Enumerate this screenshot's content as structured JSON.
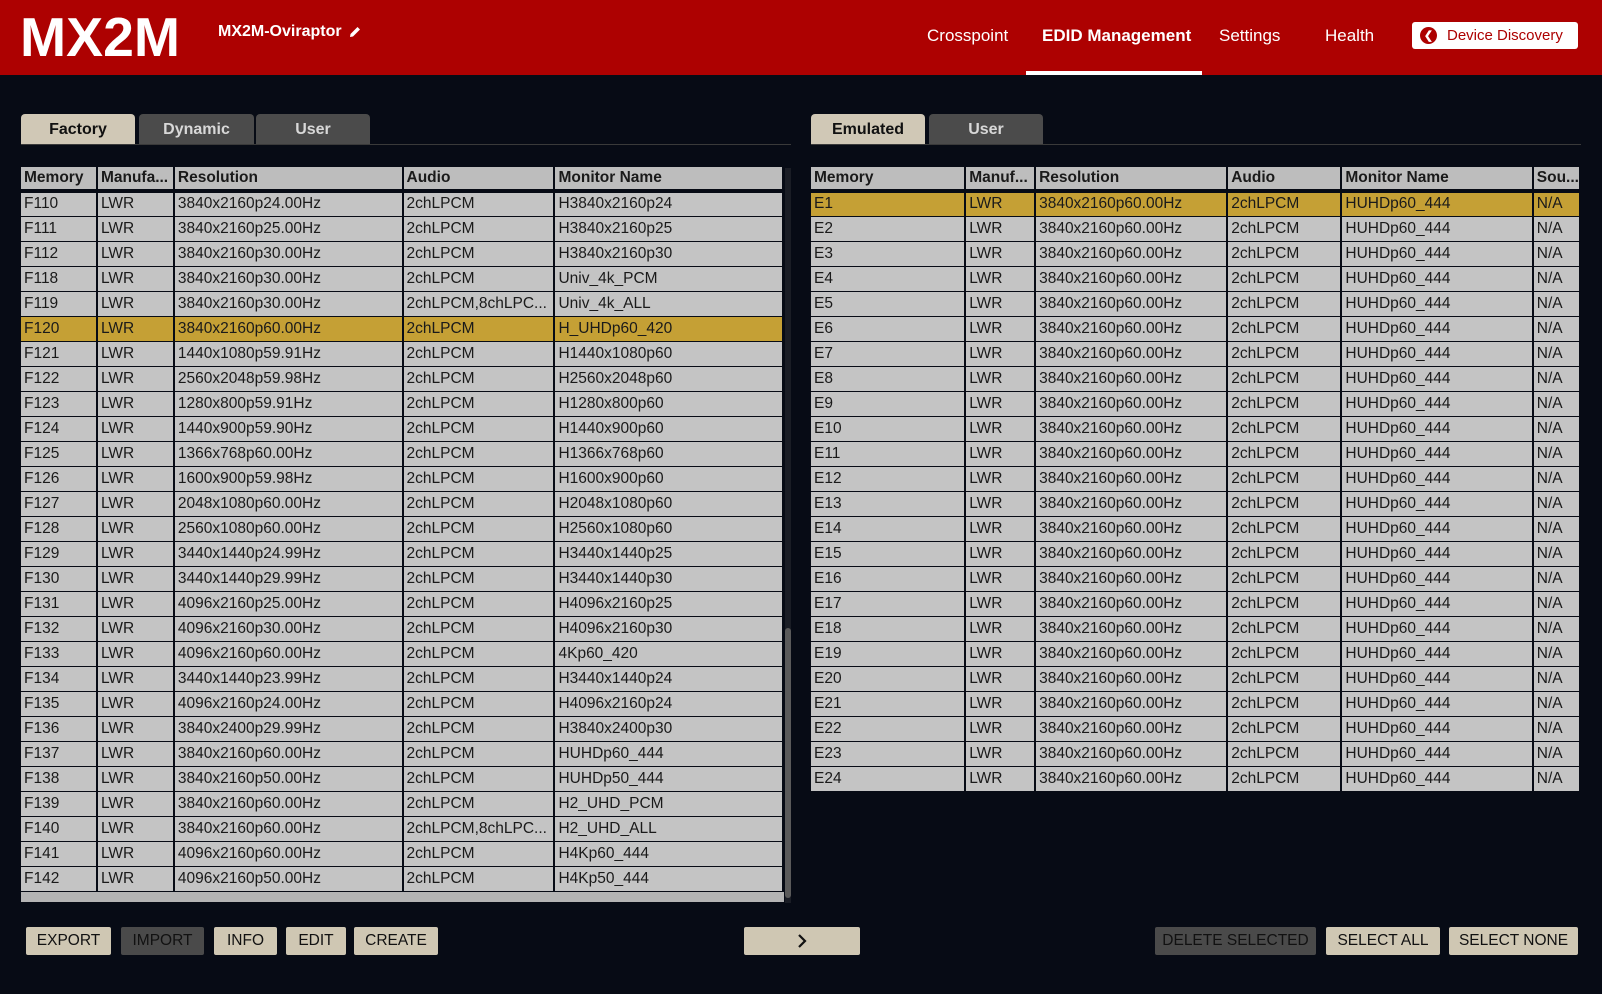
{
  "header": {
    "logo_text": "MX2M",
    "device_name": "MX2M-Oviraptor",
    "nav": [
      "Crosspoint",
      "EDID Management",
      "Settings",
      "Health"
    ],
    "active_nav": "EDID Management",
    "discovery_label": "Device Discovery",
    "brand_color": "#ad0101"
  },
  "left_panel": {
    "tabs": [
      "Factory",
      "Dynamic",
      "User"
    ],
    "active_tab": "Factory",
    "columns": [
      "Memory",
      "Manufa...",
      "Resolution",
      "Audio",
      "Monitor Name"
    ],
    "selected_row": "F120",
    "rows": [
      [
        "F110",
        "LWR",
        "3840x2160p24.00Hz",
        "2chLPCM",
        "H3840x2160p24"
      ],
      [
        "F111",
        "LWR",
        "3840x2160p25.00Hz",
        "2chLPCM",
        "H3840x2160p25"
      ],
      [
        "F112",
        "LWR",
        "3840x2160p30.00Hz",
        "2chLPCM",
        "H3840x2160p30"
      ],
      [
        "F118",
        "LWR",
        "3840x2160p30.00Hz",
        "2chLPCM",
        "Univ_4k_PCM"
      ],
      [
        "F119",
        "LWR",
        "3840x2160p30.00Hz",
        "2chLPCM,8chLPC...",
        "Univ_4k_ALL"
      ],
      [
        "F120",
        "LWR",
        "3840x2160p60.00Hz",
        "2chLPCM",
        "H_UHDp60_420"
      ],
      [
        "F121",
        "LWR",
        "1440x1080p59.91Hz",
        "2chLPCM",
        "H1440x1080p60"
      ],
      [
        "F122",
        "LWR",
        "2560x2048p59.98Hz",
        "2chLPCM",
        "H2560x2048p60"
      ],
      [
        "F123",
        "LWR",
        "1280x800p59.91Hz",
        "2chLPCM",
        "H1280x800p60"
      ],
      [
        "F124",
        "LWR",
        "1440x900p59.90Hz",
        "2chLPCM",
        "H1440x900p60"
      ],
      [
        "F125",
        "LWR",
        "1366x768p60.00Hz",
        "2chLPCM",
        "H1366x768p60"
      ],
      [
        "F126",
        "LWR",
        "1600x900p59.98Hz",
        "2chLPCM",
        "H1600x900p60"
      ],
      [
        "F127",
        "LWR",
        "2048x1080p60.00Hz",
        "2chLPCM",
        "H2048x1080p60"
      ],
      [
        "F128",
        "LWR",
        "2560x1080p60.00Hz",
        "2chLPCM",
        "H2560x1080p60"
      ],
      [
        "F129",
        "LWR",
        "3440x1440p24.99Hz",
        "2chLPCM",
        "H3440x1440p25"
      ],
      [
        "F130",
        "LWR",
        "3440x1440p29.99Hz",
        "2chLPCM",
        "H3440x1440p30"
      ],
      [
        "F131",
        "LWR",
        "4096x2160p25.00Hz",
        "2chLPCM",
        "H4096x2160p25"
      ],
      [
        "F132",
        "LWR",
        "4096x2160p30.00Hz",
        "2chLPCM",
        "H4096x2160p30"
      ],
      [
        "F133",
        "LWR",
        "4096x2160p60.00Hz",
        "2chLPCM",
        "4Kp60_420"
      ],
      [
        "F134",
        "LWR",
        "3440x1440p23.99Hz",
        "2chLPCM",
        "H3440x1440p24"
      ],
      [
        "F135",
        "LWR",
        "4096x2160p24.00Hz",
        "2chLPCM",
        "H4096x2160p24"
      ],
      [
        "F136",
        "LWR",
        "3840x2400p29.99Hz",
        "2chLPCM",
        "H3840x2400p30"
      ],
      [
        "F137",
        "LWR",
        "3840x2160p60.00Hz",
        "2chLPCM",
        "HUHDp60_444"
      ],
      [
        "F138",
        "LWR",
        "3840x2160p50.00Hz",
        "2chLPCM",
        "HUHDp50_444"
      ],
      [
        "F139",
        "LWR",
        "3840x2160p60.00Hz",
        "2chLPCM",
        "H2_UHD_PCM"
      ],
      [
        "F140",
        "LWR",
        "3840x2160p60.00Hz",
        "2chLPCM,8chLPC...",
        "H2_UHD_ALL"
      ],
      [
        "F141",
        "LWR",
        "4096x2160p60.00Hz",
        "2chLPCM",
        "H4Kp60_444"
      ],
      [
        "F142",
        "LWR",
        "4096x2160p50.00Hz",
        "2chLPCM",
        "H4Kp50_444"
      ]
    ],
    "buttons": [
      "EXPORT",
      "IMPORT",
      "INFO",
      "EDIT",
      "CREATE"
    ]
  },
  "right_panel": {
    "tabs": [
      "Emulated",
      "User"
    ],
    "active_tab": "Emulated",
    "columns": [
      "Memory",
      "Manuf...",
      "Resolution",
      "Audio",
      "Monitor Name",
      "Sou..."
    ],
    "selected_row": "E1",
    "rows": [
      [
        "E1",
        "LWR",
        "3840x2160p60.00Hz",
        "2chLPCM",
        "HUHDp60_444",
        "N/A"
      ],
      [
        "E2",
        "LWR",
        "3840x2160p60.00Hz",
        "2chLPCM",
        "HUHDp60_444",
        "N/A"
      ],
      [
        "E3",
        "LWR",
        "3840x2160p60.00Hz",
        "2chLPCM",
        "HUHDp60_444",
        "N/A"
      ],
      [
        "E4",
        "LWR",
        "3840x2160p60.00Hz",
        "2chLPCM",
        "HUHDp60_444",
        "N/A"
      ],
      [
        "E5",
        "LWR",
        "3840x2160p60.00Hz",
        "2chLPCM",
        "HUHDp60_444",
        "N/A"
      ],
      [
        "E6",
        "LWR",
        "3840x2160p60.00Hz",
        "2chLPCM",
        "HUHDp60_444",
        "N/A"
      ],
      [
        "E7",
        "LWR",
        "3840x2160p60.00Hz",
        "2chLPCM",
        "HUHDp60_444",
        "N/A"
      ],
      [
        "E8",
        "LWR",
        "3840x2160p60.00Hz",
        "2chLPCM",
        "HUHDp60_444",
        "N/A"
      ],
      [
        "E9",
        "LWR",
        "3840x2160p60.00Hz",
        "2chLPCM",
        "HUHDp60_444",
        "N/A"
      ],
      [
        "E10",
        "LWR",
        "3840x2160p60.00Hz",
        "2chLPCM",
        "HUHDp60_444",
        "N/A"
      ],
      [
        "E11",
        "LWR",
        "3840x2160p60.00Hz",
        "2chLPCM",
        "HUHDp60_444",
        "N/A"
      ],
      [
        "E12",
        "LWR",
        "3840x2160p60.00Hz",
        "2chLPCM",
        "HUHDp60_444",
        "N/A"
      ],
      [
        "E13",
        "LWR",
        "3840x2160p60.00Hz",
        "2chLPCM",
        "HUHDp60_444",
        "N/A"
      ],
      [
        "E14",
        "LWR",
        "3840x2160p60.00Hz",
        "2chLPCM",
        "HUHDp60_444",
        "N/A"
      ],
      [
        "E15",
        "LWR",
        "3840x2160p60.00Hz",
        "2chLPCM",
        "HUHDp60_444",
        "N/A"
      ],
      [
        "E16",
        "LWR",
        "3840x2160p60.00Hz",
        "2chLPCM",
        "HUHDp60_444",
        "N/A"
      ],
      [
        "E17",
        "LWR",
        "3840x2160p60.00Hz",
        "2chLPCM",
        "HUHDp60_444",
        "N/A"
      ],
      [
        "E18",
        "LWR",
        "3840x2160p60.00Hz",
        "2chLPCM",
        "HUHDp60_444",
        "N/A"
      ],
      [
        "E19",
        "LWR",
        "3840x2160p60.00Hz",
        "2chLPCM",
        "HUHDp60_444",
        "N/A"
      ],
      [
        "E20",
        "LWR",
        "3840x2160p60.00Hz",
        "2chLPCM",
        "HUHDp60_444",
        "N/A"
      ],
      [
        "E21",
        "LWR",
        "3840x2160p60.00Hz",
        "2chLPCM",
        "HUHDp60_444",
        "N/A"
      ],
      [
        "E22",
        "LWR",
        "3840x2160p60.00Hz",
        "2chLPCM",
        "HUHDp60_444",
        "N/A"
      ],
      [
        "E23",
        "LWR",
        "3840x2160p60.00Hz",
        "2chLPCM",
        "HUHDp60_444",
        "N/A"
      ],
      [
        "E24",
        "LWR",
        "3840x2160p60.00Hz",
        "2chLPCM",
        "HUHDp60_444",
        "N/A"
      ]
    ],
    "buttons": [
      "DELETE SELECTED",
      "SELECT ALL",
      "SELECT NONE"
    ]
  },
  "center": {
    "move_icon": "chevron-right-icon"
  },
  "colors": {
    "selected_row": "#c5a035",
    "active_tab": "#d0c8b6",
    "button": "#cfc7b3",
    "disabled_button": "#4a4a4a"
  }
}
